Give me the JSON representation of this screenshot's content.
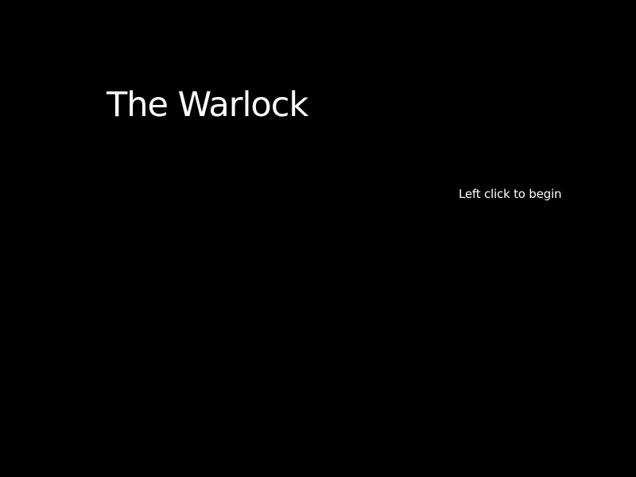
{
  "game": {
    "title": "The Warlock",
    "prompt": "Left click to begin"
  },
  "colors": {
    "background": "#000000",
    "text": "#ffffff"
  }
}
